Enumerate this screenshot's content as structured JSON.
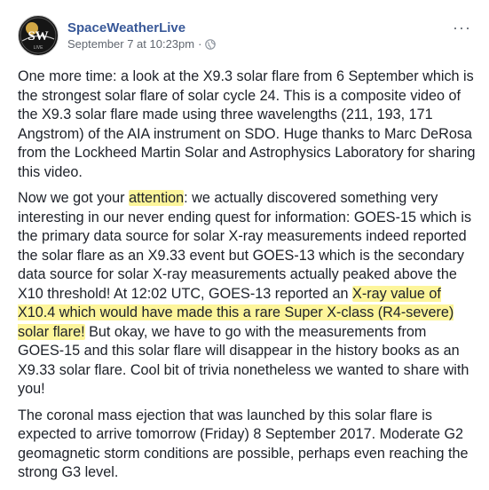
{
  "page": {
    "name": "SpaceWeatherLive",
    "timestamp": "September 7 at 10:23pm",
    "separator": "·",
    "avatar_text": "SW"
  },
  "menu": {
    "more_label": "···"
  },
  "post": {
    "para1": "One more time: a look at the X9.3 solar flare from 6 September which is the strongest solar flare of solar cycle 24. This is a composite video of the X9.3 solar flare made using three wavelengths (211, 193, 171 Angstrom) of the AIA instrument on SDO. Huge thanks to Marc DeRosa from the Lockheed Martin Solar and Astrophysics Laboratory for sharing this video.",
    "para2_a": "Now we got your ",
    "para2_highlight1": "attention",
    "para2_b": ": we actually discovered something very interesting in our never ending quest for information: GOES-15 which is the primary data source for solar X-ray measurements indeed reported the solar flare as an X9.33 event but GOES-13 which is the secondary data source for solar X-ray measurements actually peaked above the X10 threshold! At 12:02 UTC, GOES-13 reported an ",
    "para2_highlight2": "X-ray value of X10.4 which would have made this a rare Super X-class (R4-severe) solar flare!",
    "para2_c": " But okay, we have to go with the measurements from GOES-15 and this solar flare will disappear in the history books as an X9.33 solar flare. Cool bit of trivia nonetheless we wanted to share with you!",
    "para3": "The coronal mass ejection that was launched by this solar flare is expected to arrive tomorrow (Friday) 8 September 2017. Moderate G2 geomagnetic storm conditions are possible, perhaps even reaching the strong G3 level."
  },
  "colors": {
    "link": "#385898",
    "highlight": "#fdf59b",
    "text": "#1d2129",
    "meta": "#616770"
  },
  "icons": {
    "privacy": "globe-icon",
    "more": "more-options-icon"
  }
}
